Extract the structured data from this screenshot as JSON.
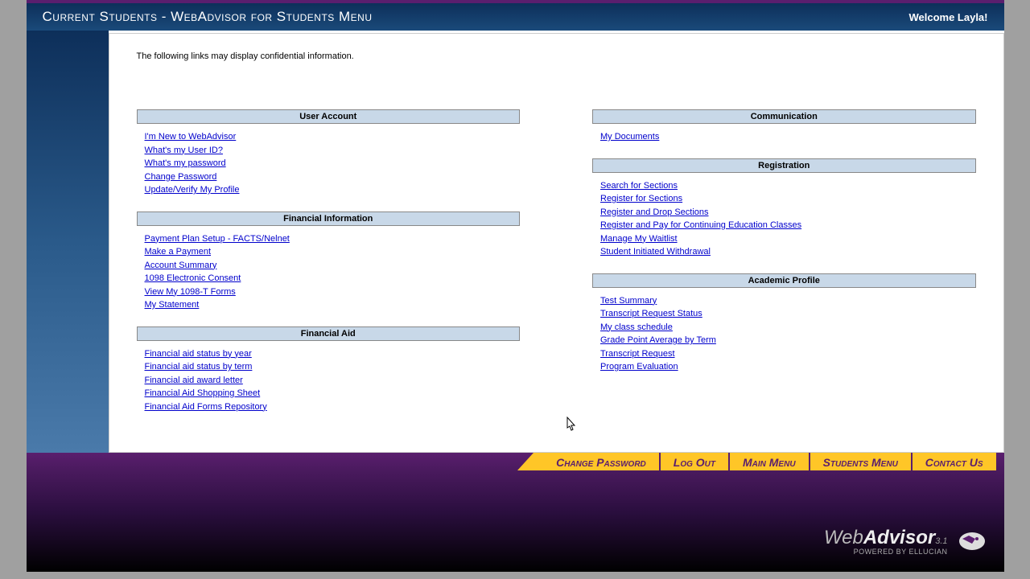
{
  "header": {
    "title": "Current Students - WebAdvisor for Students Menu",
    "welcome": "Welcome Layla!"
  },
  "notice": "The following links may display confidential information.",
  "left_sections": [
    {
      "title": "User Account",
      "links": [
        "I'm New to WebAdvisor",
        "What's my User ID?",
        "What's my password",
        "Change Password",
        "Update/Verify My Profile"
      ]
    },
    {
      "title": "Financial Information",
      "links": [
        "Payment Plan Setup - FACTS/Nelnet",
        "Make a Payment",
        "Account Summary",
        "1098 Electronic Consent",
        "View My 1098-T Forms",
        "My Statement"
      ]
    },
    {
      "title": "Financial Aid",
      "links": [
        "Financial aid status by year",
        "Financial aid status by term",
        "Financial aid award letter",
        "Financial Aid Shopping Sheet",
        "Financial Aid Forms Repository"
      ]
    }
  ],
  "right_sections": [
    {
      "title": "Communication",
      "links": [
        "My Documents"
      ]
    },
    {
      "title": "Registration",
      "links": [
        "Search for Sections",
        "Register for Sections",
        "Register and Drop Sections",
        "Register and Pay for Continuing Education Classes",
        "Manage My Waitlist",
        "Student Initiated Withdrawal"
      ]
    },
    {
      "title": "Academic Profile",
      "links": [
        "Test Summary",
        "Transcript Request Status",
        "My class schedule",
        "Grade Point Average by Term",
        "Transcript Request",
        "Program Evaluation"
      ]
    }
  ],
  "nav": [
    "Change Password",
    "Log Out",
    "Main Menu",
    "Students Menu",
    "Contact Us"
  ],
  "logo": {
    "web": "Web",
    "advisor": "Advisor",
    "version": "3.1",
    "powered": "POWERED BY ELLUCIAN"
  }
}
